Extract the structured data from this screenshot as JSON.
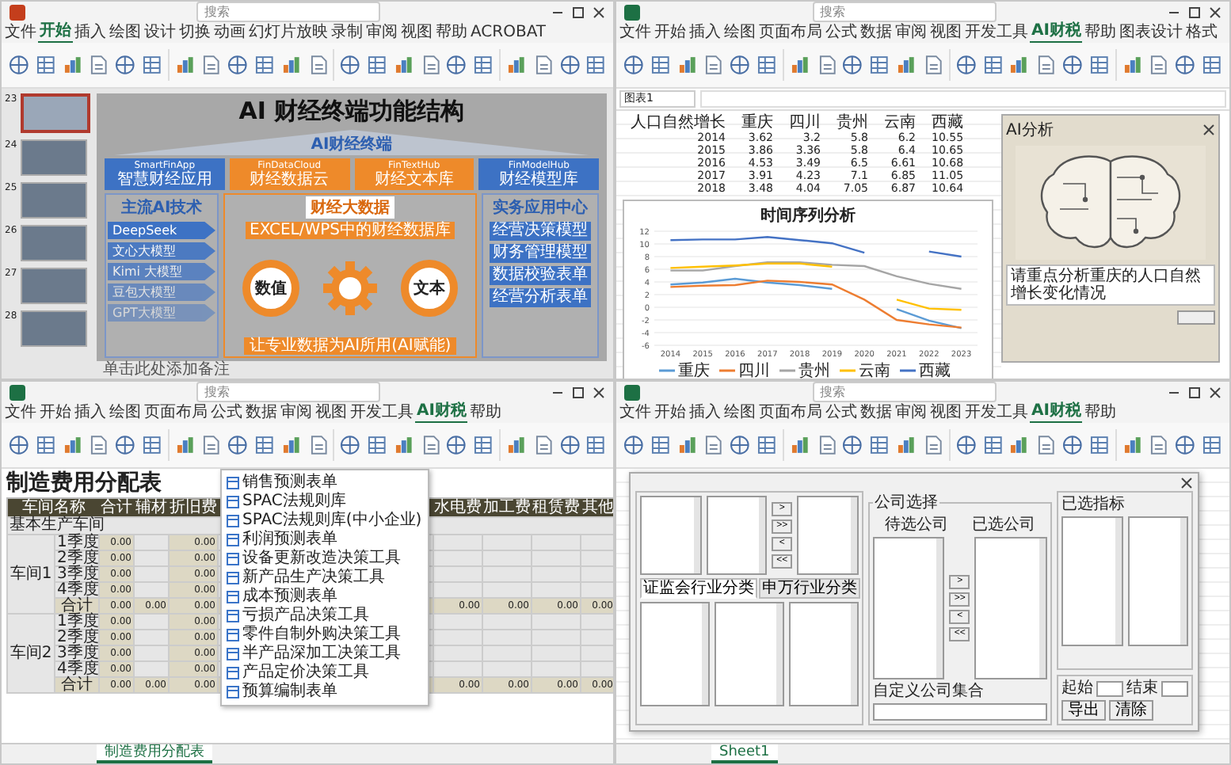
{
  "windows": [
    {
      "kind": "slides",
      "search": "搜索",
      "tabs": [
        {
          "label": "文件",
          "selected": false
        },
        {
          "label": "开始",
          "selected": true
        },
        {
          "label": "插入",
          "selected": false
        },
        {
          "label": "绘图",
          "selected": false
        },
        {
          "label": "设计",
          "selected": false
        },
        {
          "label": "切换",
          "selected": false
        },
        {
          "label": "动画",
          "selected": false
        },
        {
          "label": "幻灯片放映",
          "selected": false
        },
        {
          "label": "录制",
          "selected": false
        },
        {
          "label": "审阅",
          "selected": false
        },
        {
          "label": "视图",
          "selected": false
        },
        {
          "label": "帮助",
          "selected": false
        },
        {
          "label": "ACROBAT",
          "selected": false
        }
      ],
      "thumbnails": [
        {
          "number": "23",
          "selected": true
        },
        {
          "number": "24",
          "selected": false
        },
        {
          "number": "25",
          "selected": false
        },
        {
          "number": "26",
          "selected": false
        },
        {
          "number": "27",
          "selected": false
        },
        {
          "number": "28",
          "selected": false
        }
      ],
      "slide": {
        "title": "AI 财经终端功能结构",
        "banner": "AI财经终端",
        "modules": [
          {
            "en": "SmartFinApp",
            "zh": "智慧财经应用",
            "color": "#3d72c4"
          },
          {
            "en": "FinDataCloud",
            "zh": "财经数据云",
            "color": "#ee8a2a"
          },
          {
            "en": "FinTextHub",
            "zh": "财经文本库",
            "color": "#ee8a2a"
          },
          {
            "en": "FinModelHub",
            "zh": "财经模型库",
            "color": "#3d72c4"
          }
        ],
        "left_panel": {
          "title": "主流AI技术",
          "items": [
            "DeepSeek",
            "文心大模型",
            "Kimi 大模型",
            "豆包大模型",
            "GPT大模型"
          ]
        },
        "center_panel": {
          "title": "财经大数据",
          "caption": "EXCEL/WPS中的财经数据库",
          "gears": [
            "数值",
            "文本"
          ],
          "footer": "让专业数据为AI所用(AI赋能)"
        },
        "right_panel": {
          "title": "实务应用中心",
          "items": [
            "经营决策模型",
            "财务管理模型",
            "数据校验表单",
            "经营分析表单"
          ]
        }
      },
      "notes": "单击此处添加备注"
    },
    {
      "kind": "chart_sheet",
      "search": "搜索",
      "tabs": [
        {
          "label": "文件",
          "selected": false
        },
        {
          "label": "开始",
          "selected": false
        },
        {
          "label": "插入",
          "selected": false
        },
        {
          "label": "绘图",
          "selected": false
        },
        {
          "label": "页面布局",
          "selected": false
        },
        {
          "label": "公式",
          "selected": false
        },
        {
          "label": "数据",
          "selected": false
        },
        {
          "label": "审阅",
          "selected": false
        },
        {
          "label": "视图",
          "selected": false
        },
        {
          "label": "开发工具",
          "selected": false
        },
        {
          "label": "AI财税",
          "selected": true
        },
        {
          "label": "帮助",
          "selected": false
        },
        {
          "label": "图表设计",
          "selected": false
        },
        {
          "label": "格式",
          "selected": false
        }
      ],
      "name_box": "图表1",
      "data": {
        "header": [
          "人口自然增长",
          "重庆",
          "四川",
          "贵州",
          "云南",
          "西藏"
        ],
        "rows": [
          [
            "2014",
            "3.62",
            "3.2",
            "5.8",
            "6.2",
            "10.55"
          ],
          [
            "2015",
            "3.86",
            "3.36",
            "5.8",
            "6.4",
            "10.65"
          ],
          [
            "2016",
            "4.53",
            "3.49",
            "6.5",
            "6.61",
            "10.68"
          ],
          [
            "2017",
            "3.91",
            "4.23",
            "7.1",
            "6.85",
            "11.05"
          ],
          [
            "2018",
            "3.48",
            "4.04",
            "7.05",
            "6.87",
            "10.64"
          ]
        ]
      },
      "chart_data": {
        "type": "line",
        "title": "时间序列分析",
        "categories": [
          "2014",
          "2015",
          "2016",
          "2017",
          "2018",
          "2019",
          "2020",
          "2021",
          "2022",
          "2023"
        ],
        "ylim": [
          -6,
          12
        ],
        "yticks": [
          -6,
          -4,
          -2,
          0,
          2,
          4,
          6,
          8,
          10,
          12
        ],
        "grid": true,
        "legend": true,
        "series": [
          {
            "name": "重庆",
            "color": "#5b9bd5",
            "values": [
              3.6,
              3.9,
              4.5,
              3.9,
              3.5,
              2.9,
              null,
              -0.3,
              -2.1,
              -3.3
            ]
          },
          {
            "name": "四川",
            "color": "#ed7d31",
            "values": [
              3.2,
              3.4,
              3.5,
              4.2,
              4.0,
              3.6,
              1.2,
              -2.0,
              -2.7,
              -3.2
            ]
          },
          {
            "name": "贵州",
            "color": "#a5a5a5",
            "values": [
              5.8,
              5.8,
              6.5,
              7.1,
              7.1,
              6.7,
              6.5,
              4.9,
              3.7,
              2.9
            ]
          },
          {
            "name": "云南",
            "color": "#ffc000",
            "values": [
              6.2,
              6.4,
              6.6,
              6.9,
              6.9,
              6.4,
              null,
              1.2,
              -0.2,
              -0.4
            ]
          },
          {
            "name": "西藏",
            "color": "#4472c4",
            "values": [
              10.6,
              10.7,
              10.7,
              11.1,
              10.6,
              10.1,
              8.6,
              null,
              8.8,
              8.0
            ]
          }
        ]
      },
      "ai_dialog": {
        "title": "AI分析",
        "prompt": "请重点分析重庆的人口自然增长变化情况"
      }
    },
    {
      "kind": "cost_sheet",
      "search": "搜索",
      "tabs": [
        {
          "label": "文件",
          "selected": false
        },
        {
          "label": "开始",
          "selected": false
        },
        {
          "label": "插入",
          "selected": false
        },
        {
          "label": "绘图",
          "selected": false
        },
        {
          "label": "页面布局",
          "selected": false
        },
        {
          "label": "公式",
          "selected": false
        },
        {
          "label": "数据",
          "selected": false
        },
        {
          "label": "审阅",
          "selected": false
        },
        {
          "label": "视图",
          "selected": false
        },
        {
          "label": "开发工具",
          "selected": false
        },
        {
          "label": "AI财税",
          "selected": true
        },
        {
          "label": "帮助",
          "selected": false
        }
      ],
      "sheet": {
        "title": "制造费用分配表",
        "columns": [
          "车间名称",
          "合计",
          "辅材",
          "折旧费",
          "水电费",
          "加工费",
          "租赁费",
          "其他"
        ],
        "groups": [
          {
            "label": "基本生产车间",
            "workshops": [
              {
                "name": "车间1",
                "rows": [
                  {
                    "label": "1季度",
                    "total": false,
                    "cells": [
                      {
                        "kind": "value",
                        "text": "0.00"
                      },
                      {
                        "kind": "blank"
                      },
                      {
                        "kind": "value",
                        "text": "0.00"
                      },
                      {
                        "kind": "blank"
                      },
                      {
                        "kind": "blank"
                      },
                      {
                        "kind": "blank"
                      },
                      {
                        "kind": "blank"
                      }
                    ]
                  },
                  {
                    "label": "2季度",
                    "total": false,
                    "cells": [
                      {
                        "kind": "value",
                        "text": "0.00"
                      },
                      {
                        "kind": "blank"
                      },
                      {
                        "kind": "value",
                        "text": "0.00"
                      },
                      {
                        "kind": "blank"
                      },
                      {
                        "kind": "blank"
                      },
                      {
                        "kind": "blank"
                      },
                      {
                        "kind": "blank"
                      }
                    ]
                  },
                  {
                    "label": "3季度",
                    "total": false,
                    "cells": [
                      {
                        "kind": "value",
                        "text": "0.00"
                      },
                      {
                        "kind": "blank"
                      },
                      {
                        "kind": "value",
                        "text": "0.00"
                      },
                      {
                        "kind": "blank"
                      },
                      {
                        "kind": "blank"
                      },
                      {
                        "kind": "blank"
                      },
                      {
                        "kind": "blank"
                      }
                    ]
                  },
                  {
                    "label": "4季度",
                    "total": false,
                    "cells": [
                      {
                        "kind": "value",
                        "text": "0.00"
                      },
                      {
                        "kind": "blank"
                      },
                      {
                        "kind": "value",
                        "text": "0.00"
                      },
                      {
                        "kind": "blank"
                      },
                      {
                        "kind": "blank"
                      },
                      {
                        "kind": "blank"
                      },
                      {
                        "kind": "blank"
                      }
                    ]
                  },
                  {
                    "label": "合计",
                    "total": true,
                    "cells": [
                      {
                        "kind": "value",
                        "text": "0.00"
                      },
                      {
                        "kind": "value",
                        "text": "0.00"
                      },
                      {
                        "kind": "value",
                        "text": "0.00"
                      },
                      {
                        "kind": "value",
                        "text": "0.00"
                      },
                      {
                        "kind": "value",
                        "text": "0.00"
                      },
                      {
                        "kind": "value",
                        "text": "0.00"
                      },
                      {
                        "kind": "value",
                        "text": "0.00"
                      }
                    ]
                  }
                ]
              },
              {
                "name": "车间2",
                "rows": [
                  {
                    "label": "1季度",
                    "total": false,
                    "cells": [
                      {
                        "kind": "value",
                        "text": "0.00"
                      },
                      {
                        "kind": "blank"
                      },
                      {
                        "kind": "value",
                        "text": "0.00"
                      },
                      {
                        "kind": "blank"
                      },
                      {
                        "kind": "blank"
                      },
                      {
                        "kind": "blank"
                      },
                      {
                        "kind": "blank"
                      }
                    ]
                  },
                  {
                    "label": "2季度",
                    "total": false,
                    "cells": [
                      {
                        "kind": "value",
                        "text": "0.00"
                      },
                      {
                        "kind": "blank"
                      },
                      {
                        "kind": "value",
                        "text": "0.00"
                      },
                      {
                        "kind": "blank"
                      },
                      {
                        "kind": "blank"
                      },
                      {
                        "kind": "blank"
                      },
                      {
                        "kind": "blank"
                      }
                    ]
                  },
                  {
                    "label": "3季度",
                    "total": false,
                    "cells": [
                      {
                        "kind": "value",
                        "text": "0.00"
                      },
                      {
                        "kind": "blank"
                      },
                      {
                        "kind": "value",
                        "text": "0.00"
                      },
                      {
                        "kind": "blank"
                      },
                      {
                        "kind": "blank"
                      },
                      {
                        "kind": "blank"
                      },
                      {
                        "kind": "blank"
                      }
                    ]
                  },
                  {
                    "label": "4季度",
                    "total": false,
                    "cells": [
                      {
                        "kind": "value",
                        "text": "0.00"
                      },
                      {
                        "kind": "blank"
                      },
                      {
                        "kind": "value",
                        "text": "0.00"
                      },
                      {
                        "kind": "blank"
                      },
                      {
                        "kind": "blank"
                      },
                      {
                        "kind": "blank"
                      },
                      {
                        "kind": "blank"
                      }
                    ]
                  },
                  {
                    "label": "合计",
                    "total": true,
                    "cells": [
                      {
                        "kind": "value",
                        "text": "0.00"
                      },
                      {
                        "kind": "value",
                        "text": "0.00"
                      },
                      {
                        "kind": "value",
                        "text": "0.00"
                      },
                      {
                        "kind": "value",
                        "text": "0.00"
                      },
                      {
                        "kind": "value",
                        "text": "0.00"
                      },
                      {
                        "kind": "value",
                        "text": "0.00"
                      },
                      {
                        "kind": "value",
                        "text": "0.00"
                      }
                    ]
                  }
                ]
              }
            ]
          }
        ]
      },
      "menu": [
        "销售预测表单",
        "SPAC法规则库",
        "SPAC法规则库(中小企业)",
        "利润预测表单",
        "设备更新改造决策工具",
        "新产品生产决策工具",
        "成本预测表单",
        "亏损产品决策工具",
        "零件自制外购决策工具",
        "半产品深加工决策工具",
        "产品定价决策工具",
        "预算编制表单"
      ],
      "sheet_tabs": [
        {
          "label": "制造费用分配表",
          "selected": true
        }
      ]
    },
    {
      "kind": "search_dialog",
      "search": "搜索",
      "tabs": [
        {
          "label": "文件",
          "selected": false
        },
        {
          "label": "开始",
          "selected": false
        },
        {
          "label": "插入",
          "selected": false
        },
        {
          "label": "绘图",
          "selected": false
        },
        {
          "label": "页面布局",
          "selected": false
        },
        {
          "label": "公式",
          "selected": false
        },
        {
          "label": "数据",
          "selected": false
        },
        {
          "label": "审阅",
          "selected": false
        },
        {
          "label": "视图",
          "selected": false
        },
        {
          "label": "开发工具",
          "selected": false
        },
        {
          "label": "AI财税",
          "selected": true
        },
        {
          "label": "帮助",
          "selected": false
        }
      ],
      "dialog": {
        "classify_tabs": [
          {
            "label": "证监会行业分类",
            "selected": true
          },
          {
            "label": "申万行业分类",
            "selected": false
          }
        ],
        "company_group": "公司选择",
        "pending": "待选公司",
        "chosen": "已选公司",
        "custom": "自定义公司集合",
        "selected_list": "已选指标",
        "move_buttons": [
          ">",
          ">>",
          "<",
          "<<"
        ],
        "start": "起始",
        "end": "结束",
        "buttons": [
          "导出",
          "清除"
        ]
      },
      "sheet_tabs": [
        {
          "label": "Sheet1",
          "selected": true
        }
      ]
    }
  ]
}
